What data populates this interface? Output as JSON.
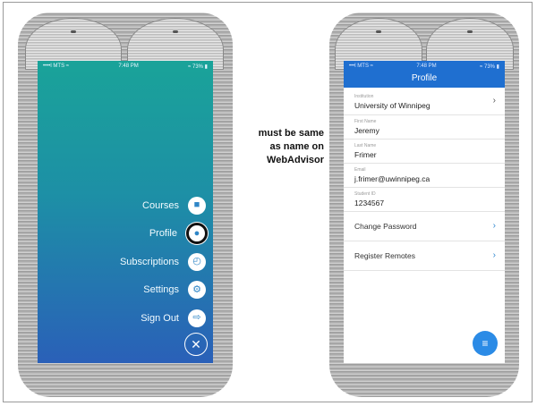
{
  "annotation": {
    "line1": "must be same",
    "line2": "as name on",
    "line3": "WebAdvisor"
  },
  "menu_screen": {
    "status": {
      "carrier": "••••l MTS ≈",
      "time": "7:48 PM",
      "battery": "≈ 73% ▮"
    },
    "items": [
      {
        "label": "Courses",
        "icon": "book-icon",
        "glyph": "■"
      },
      {
        "label": "Profile",
        "icon": "person-icon",
        "glyph": "●"
      },
      {
        "label": "Subscriptions",
        "icon": "clock-icon",
        "glyph": "◴"
      },
      {
        "label": "Settings",
        "icon": "gear-icon",
        "glyph": "⚙"
      },
      {
        "label": "Sign Out",
        "icon": "sign-out-icon",
        "glyph": "⇨"
      }
    ],
    "close_glyph": "✕"
  },
  "profile_screen": {
    "status": {
      "carrier": "•••l MTS ≈",
      "time": "7:48 PM",
      "battery": "≈ 73% ▮"
    },
    "title": "Profile",
    "fields": [
      {
        "label": "Institution",
        "value": "University of Winnipeg",
        "chevron": "›"
      },
      {
        "label": "First Name",
        "value": "Jeremy"
      },
      {
        "label": "Last Name",
        "value": "Frimer"
      },
      {
        "label": "Email",
        "value": "j.frimer@uwinnipeg.ca"
      },
      {
        "label": "Student ID",
        "value": "1234567"
      }
    ],
    "actions": [
      {
        "label": "Change Password",
        "chevron": "›"
      },
      {
        "label": "Register Remotes",
        "chevron": "›"
      }
    ],
    "fab_glyph": "≡"
  },
  "colors": {
    "menu_top": "#1aa399",
    "menu_bottom": "#2a60b8",
    "profile_header": "#1f6fd0",
    "fab": "#2b8be6"
  }
}
